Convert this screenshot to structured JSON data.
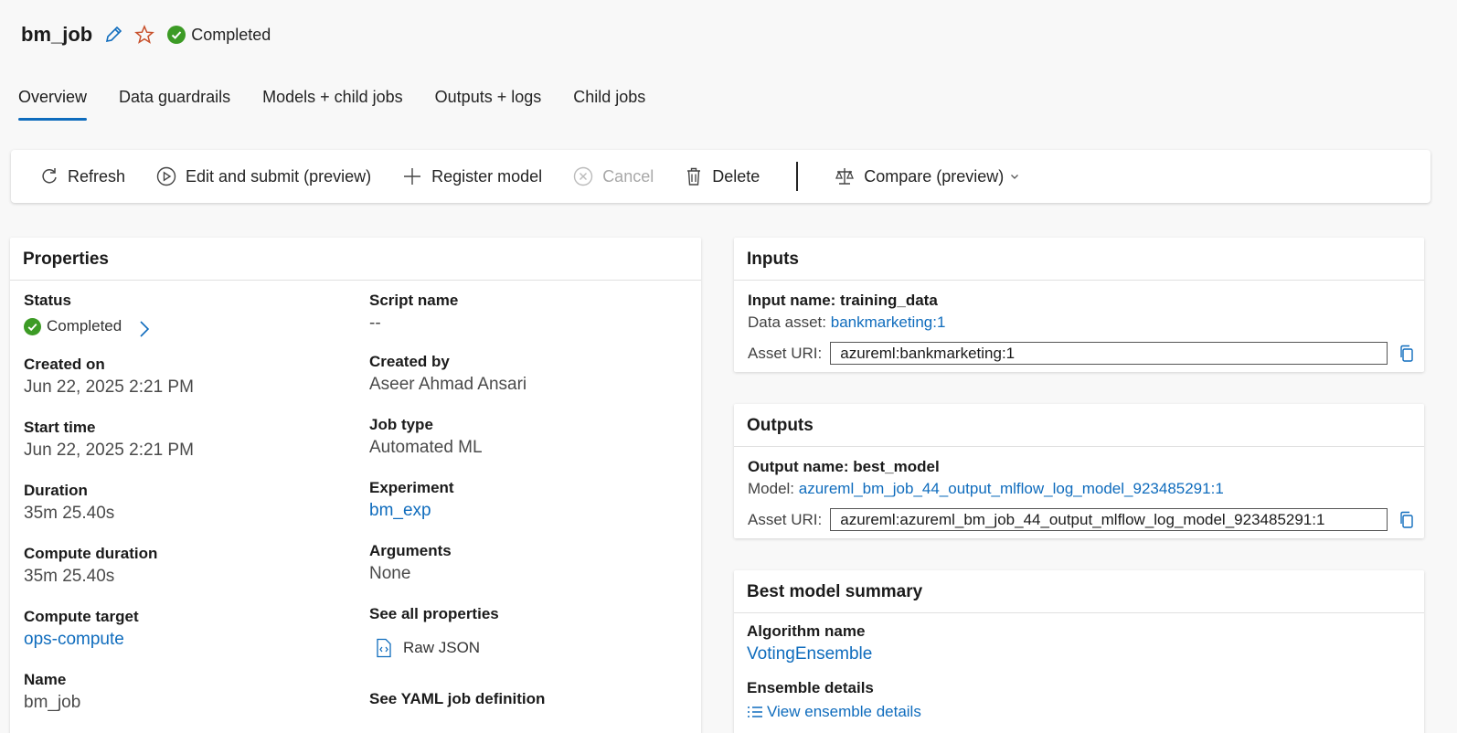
{
  "header": {
    "title": "bm_job",
    "status": "Completed"
  },
  "tabs": [
    "Overview",
    "Data guardrails",
    "Models + child jobs",
    "Outputs + logs",
    "Child jobs"
  ],
  "toolbar": {
    "refresh": "Refresh",
    "edit_submit": "Edit and submit (preview)",
    "register_model": "Register model",
    "cancel": "Cancel",
    "delete": "Delete",
    "compare": "Compare (preview)"
  },
  "properties": {
    "title": "Properties",
    "status_label": "Status",
    "status_value": "Completed",
    "created_on_label": "Created on",
    "created_on": "Jun 22, 2025 2:21 PM",
    "start_time_label": "Start time",
    "start_time": "Jun 22, 2025 2:21 PM",
    "duration_label": "Duration",
    "duration": "35m 25.40s",
    "compute_duration_label": "Compute duration",
    "compute_duration": "35m 25.40s",
    "compute_target_label": "Compute target",
    "compute_target": "ops-compute",
    "name_label": "Name",
    "name": "bm_job",
    "script_name_label": "Script name",
    "script_name": "--",
    "created_by_label": "Created by",
    "created_by": "Aseer Ahmad Ansari",
    "job_type_label": "Job type",
    "job_type": "Automated ML",
    "experiment_label": "Experiment",
    "experiment": "bm_exp",
    "arguments_label": "Arguments",
    "arguments": "None",
    "see_all_label": "See all properties",
    "raw_json": "Raw JSON",
    "yaml_label": "See YAML job definition"
  },
  "inputs": {
    "title": "Inputs",
    "input_name": "Input name: training_data",
    "data_asset_label": "Data asset:",
    "data_asset": "bankmarketing:1",
    "asset_uri_label": "Asset URI:",
    "asset_uri": "azureml:bankmarketing:1"
  },
  "outputs": {
    "title": "Outputs",
    "output_name": "Output name: best_model",
    "model_label": "Model:",
    "model": "azureml_bm_job_44_output_mlflow_log_model_923485291:1",
    "asset_uri_label": "Asset URI:",
    "asset_uri": "azureml:azureml_bm_job_44_output_mlflow_log_model_923485291:1"
  },
  "best_model": {
    "title": "Best model summary",
    "algorithm_label": "Algorithm name",
    "algorithm": "VotingEnsemble",
    "ensemble_label": "Ensemble details",
    "ensemble_link": "View ensemble details"
  },
  "colors": {
    "accent": "#0f6cbd",
    "success": "#3c9b25",
    "star": "#c8502b"
  }
}
